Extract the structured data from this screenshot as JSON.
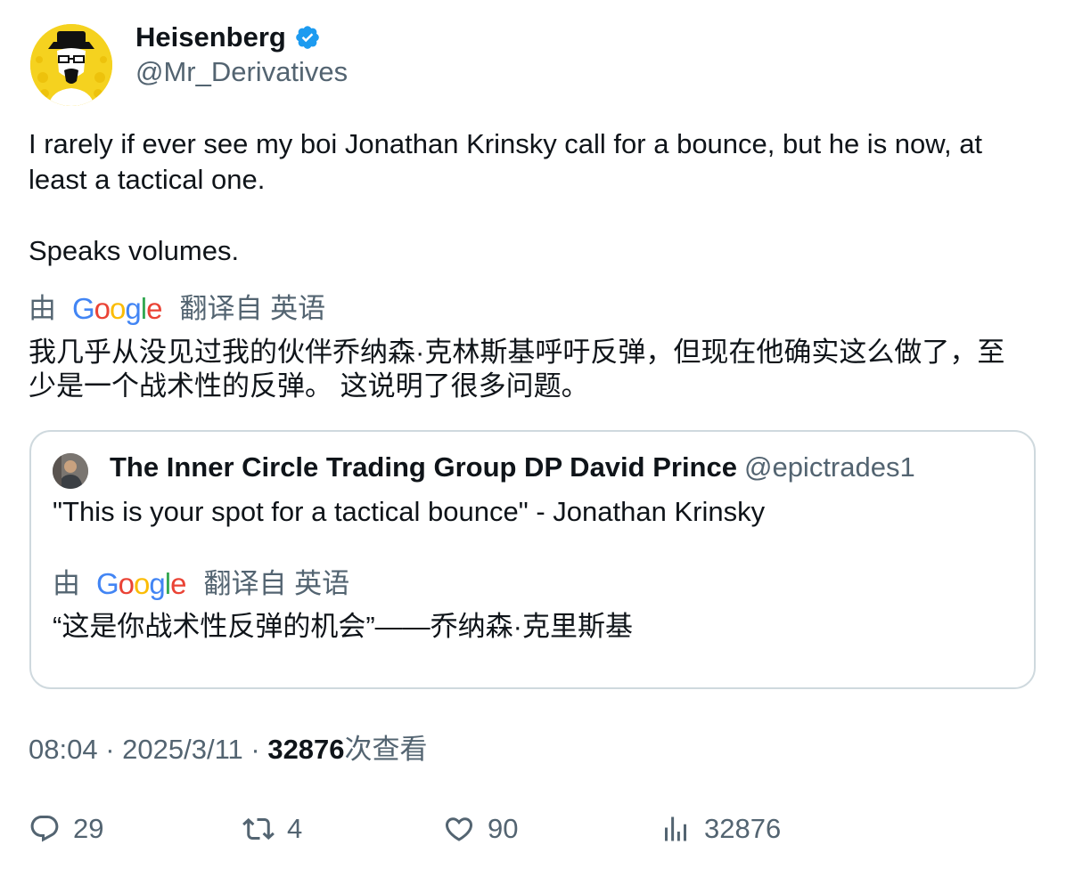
{
  "author": {
    "name": "Heisenberg",
    "handle": "@Mr_Derivatives",
    "verified": true
  },
  "tweet": {
    "paragraphs": [
      "I rarely if ever see my boi Jonathan Krinsky call for a bounce, but he is now, at least a tactical one.",
      "Speaks volumes."
    ],
    "translation": {
      "by": "由",
      "provider": "Google",
      "from": "翻译自 英语",
      "text_line1": "我几乎从没见过我的伙伴乔纳森·克林斯基呼吁反弹，但现在他确实这么做了，至",
      "text_line2": "少是一个战术性的反弹。 这说明了很多问题。"
    }
  },
  "quote": {
    "name": "The Inner Circle Trading Group DP David Prince",
    "handle": "@epictrades1",
    "text": "\"This is your spot for a tactical bounce\" - Jonathan Krinsky",
    "translation": {
      "by": "由",
      "provider": "Google",
      "from": "翻译自 英语",
      "text": "“这是你战术性反弹的机会”——乔纳森·克里斯基"
    }
  },
  "meta": {
    "time": "08:04",
    "separator": " · ",
    "date": "2025/3/11",
    "views": "32876",
    "views_label": "次查看"
  },
  "actions": {
    "replies": "29",
    "retweets": "4",
    "likes": "90",
    "views": "32876"
  },
  "colors": {
    "text": "#0f1419",
    "secondary": "#536471",
    "verified": "#1d9bf0",
    "border": "#cfd9de",
    "avatar_bg": "#f5d21f"
  },
  "icons": [
    "verified-badge-icon",
    "reply-icon",
    "retweet-icon",
    "like-icon",
    "views-icon",
    "google-logo"
  ]
}
